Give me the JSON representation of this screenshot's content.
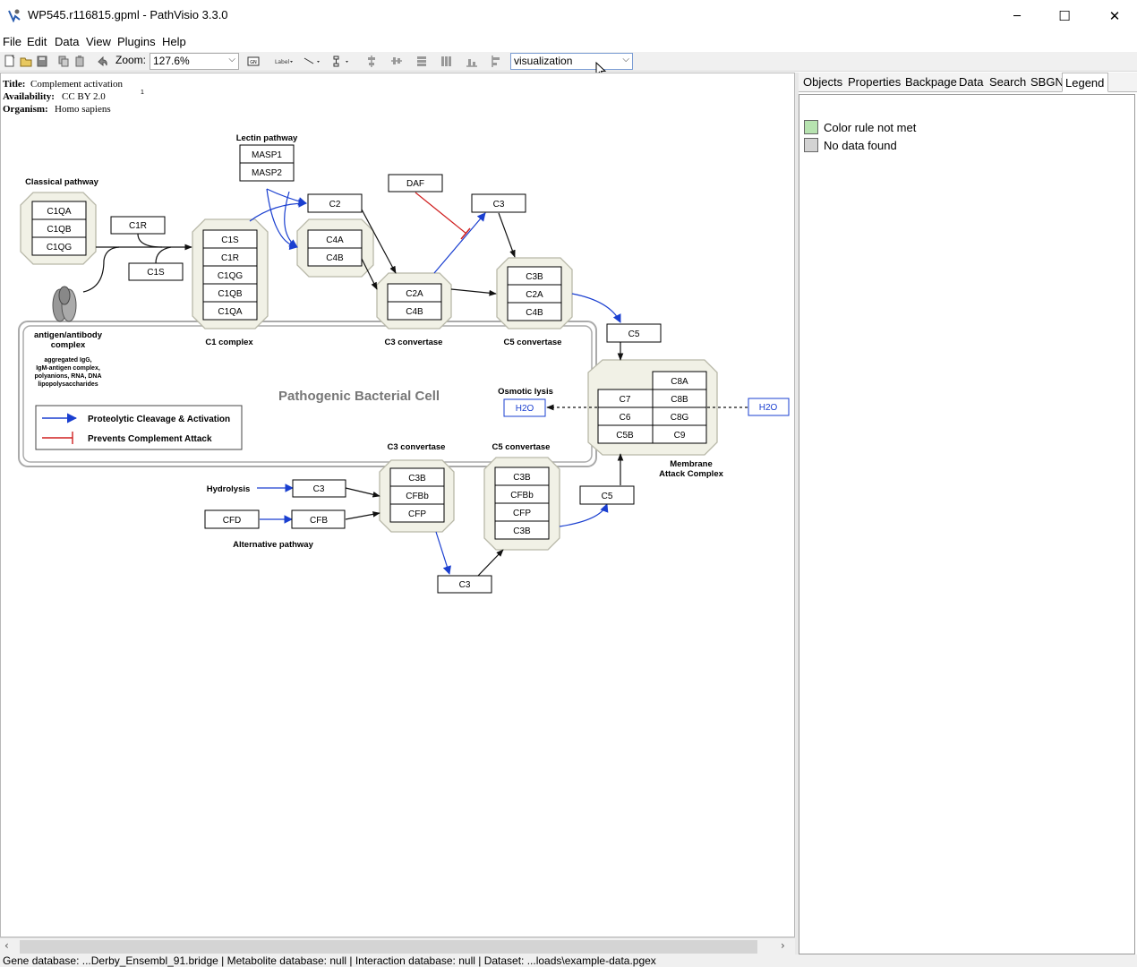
{
  "window": {
    "title": "WP545.r116815.gpml - PathVisio 3.3.0",
    "controls": {
      "minimize": "─",
      "maximize": "☐",
      "close": "✕"
    }
  },
  "menu": [
    "File",
    "Edit",
    "Data",
    "View",
    "Plugins",
    "Help"
  ],
  "toolbar": {
    "zoom_label": "Zoom:",
    "zoom_value": "127.6%",
    "visualization_value": "visualization"
  },
  "pathway_info": {
    "title_label": "Title:",
    "title_value": "Complement activation",
    "availability_label": "Availability:",
    "availability_value": "CC BY 2.0",
    "organism_label": "Organism:",
    "organism_value": "Homo sapiens",
    "footnote": "1"
  },
  "diagram": {
    "labels": {
      "lectin_pathway": "Lectin pathway",
      "classical_pathway": "Classical pathway",
      "c1_complex": "C1 complex",
      "c3_convertase_top": "C3 convertase",
      "c5_convertase_top": "C5 convertase",
      "antigen_line1": "antigen/antibody",
      "antigen_line2": "complex",
      "antigen_desc1": "aggregated IgG,",
      "antigen_desc2": "IgM-antigen complex,",
      "antigen_desc3": "polyanions, RNA, DNA",
      "antigen_desc4": "lipopolysaccharides",
      "pathogenic_cell": "Pathogenic Bacterial Cell",
      "osmotic_lysis": "Osmotic lysis",
      "mac_line1": "Membrane",
      "mac_line2": "Attack Complex",
      "c3_convertase_bottom": "C3 convertase",
      "c5_convertase_bottom": "C5 convertase",
      "hydrolysis": "Hydrolysis",
      "alternative_pathway": "Alternative pathway",
      "legend_activation": "Proteolytic Cleavage & Activation",
      "legend_prevents": "Prevents Complement Attack"
    },
    "nodes": {
      "masp1": "MASP1",
      "masp2": "MASP2",
      "c2": "C2",
      "daf": "DAF",
      "c3_top": "C3",
      "c1qa": "C1QA",
      "c1qb": "C1QB",
      "c1qg": "C1QG",
      "c1r": "C1R",
      "c1s": "C1S",
      "cx_c1s": "C1S",
      "cx_c1r": "C1R",
      "cx_c1qg": "C1QG",
      "cx_c1qb": "C1QB",
      "cx_c1qa": "C1QA",
      "c4a": "C4A",
      "c4b": "C4B",
      "c3c_c2a": "C2A",
      "c3c_c4b": "C4B",
      "c5c_c3b": "C3B",
      "c5c_c2a": "C2A",
      "c5c_c4b": "C4B",
      "c5_top": "C5",
      "mac_c8a": "C8A",
      "mac_c7": "C7",
      "mac_c8b": "C8B",
      "mac_c6": "C6",
      "mac_c8g": "C8G",
      "mac_c5b": "C5B",
      "mac_c9": "C9",
      "h2o_left": "H2O",
      "h2o_right": "H2O",
      "c3_hydro": "C3",
      "cfd": "CFD",
      "cfb": "CFB",
      "ac3_c3b": "C3B",
      "ac3_cfbb": "CFBb",
      "ac3_cfp": "CFP",
      "ac5_c3b": "C3B",
      "ac5_cfbb": "CFBb",
      "ac5_cfp": "CFP",
      "ac5_c3b2": "C3B",
      "c5_bottom": "C5",
      "c3_bottom": "C3"
    }
  },
  "side_panel": {
    "tabs": [
      "Objects",
      "Properties",
      "Backpage",
      "Data",
      "Search",
      "SBGN",
      "Legend"
    ],
    "active_tab": "Legend",
    "legend": [
      {
        "label": "Color rule not met",
        "color": "#b7e3b0"
      },
      {
        "label": "No data found",
        "color": "#d3d3d3"
      }
    ]
  },
  "status": "Gene database: ...Derby_Ensembl_91.bridge | Metabolite database: null | Interaction database: null | Dataset: ...loads\\example-data.pgex"
}
